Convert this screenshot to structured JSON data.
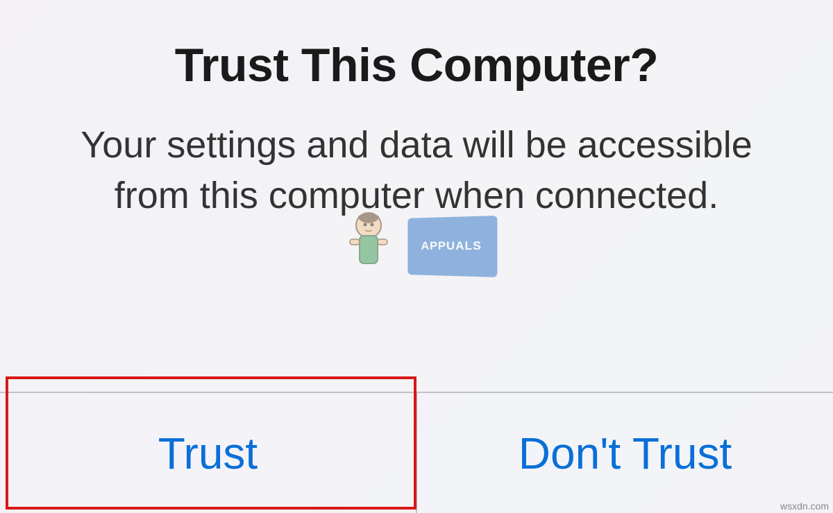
{
  "dialog": {
    "title": "Trust This Computer?",
    "message": "Your settings and data will be accessible from this computer when connected.",
    "buttons": {
      "trust": "Trust",
      "dont_trust": "Don't Trust"
    }
  },
  "watermark": {
    "label": "APPUALS"
  },
  "source": "wsxdn.com"
}
